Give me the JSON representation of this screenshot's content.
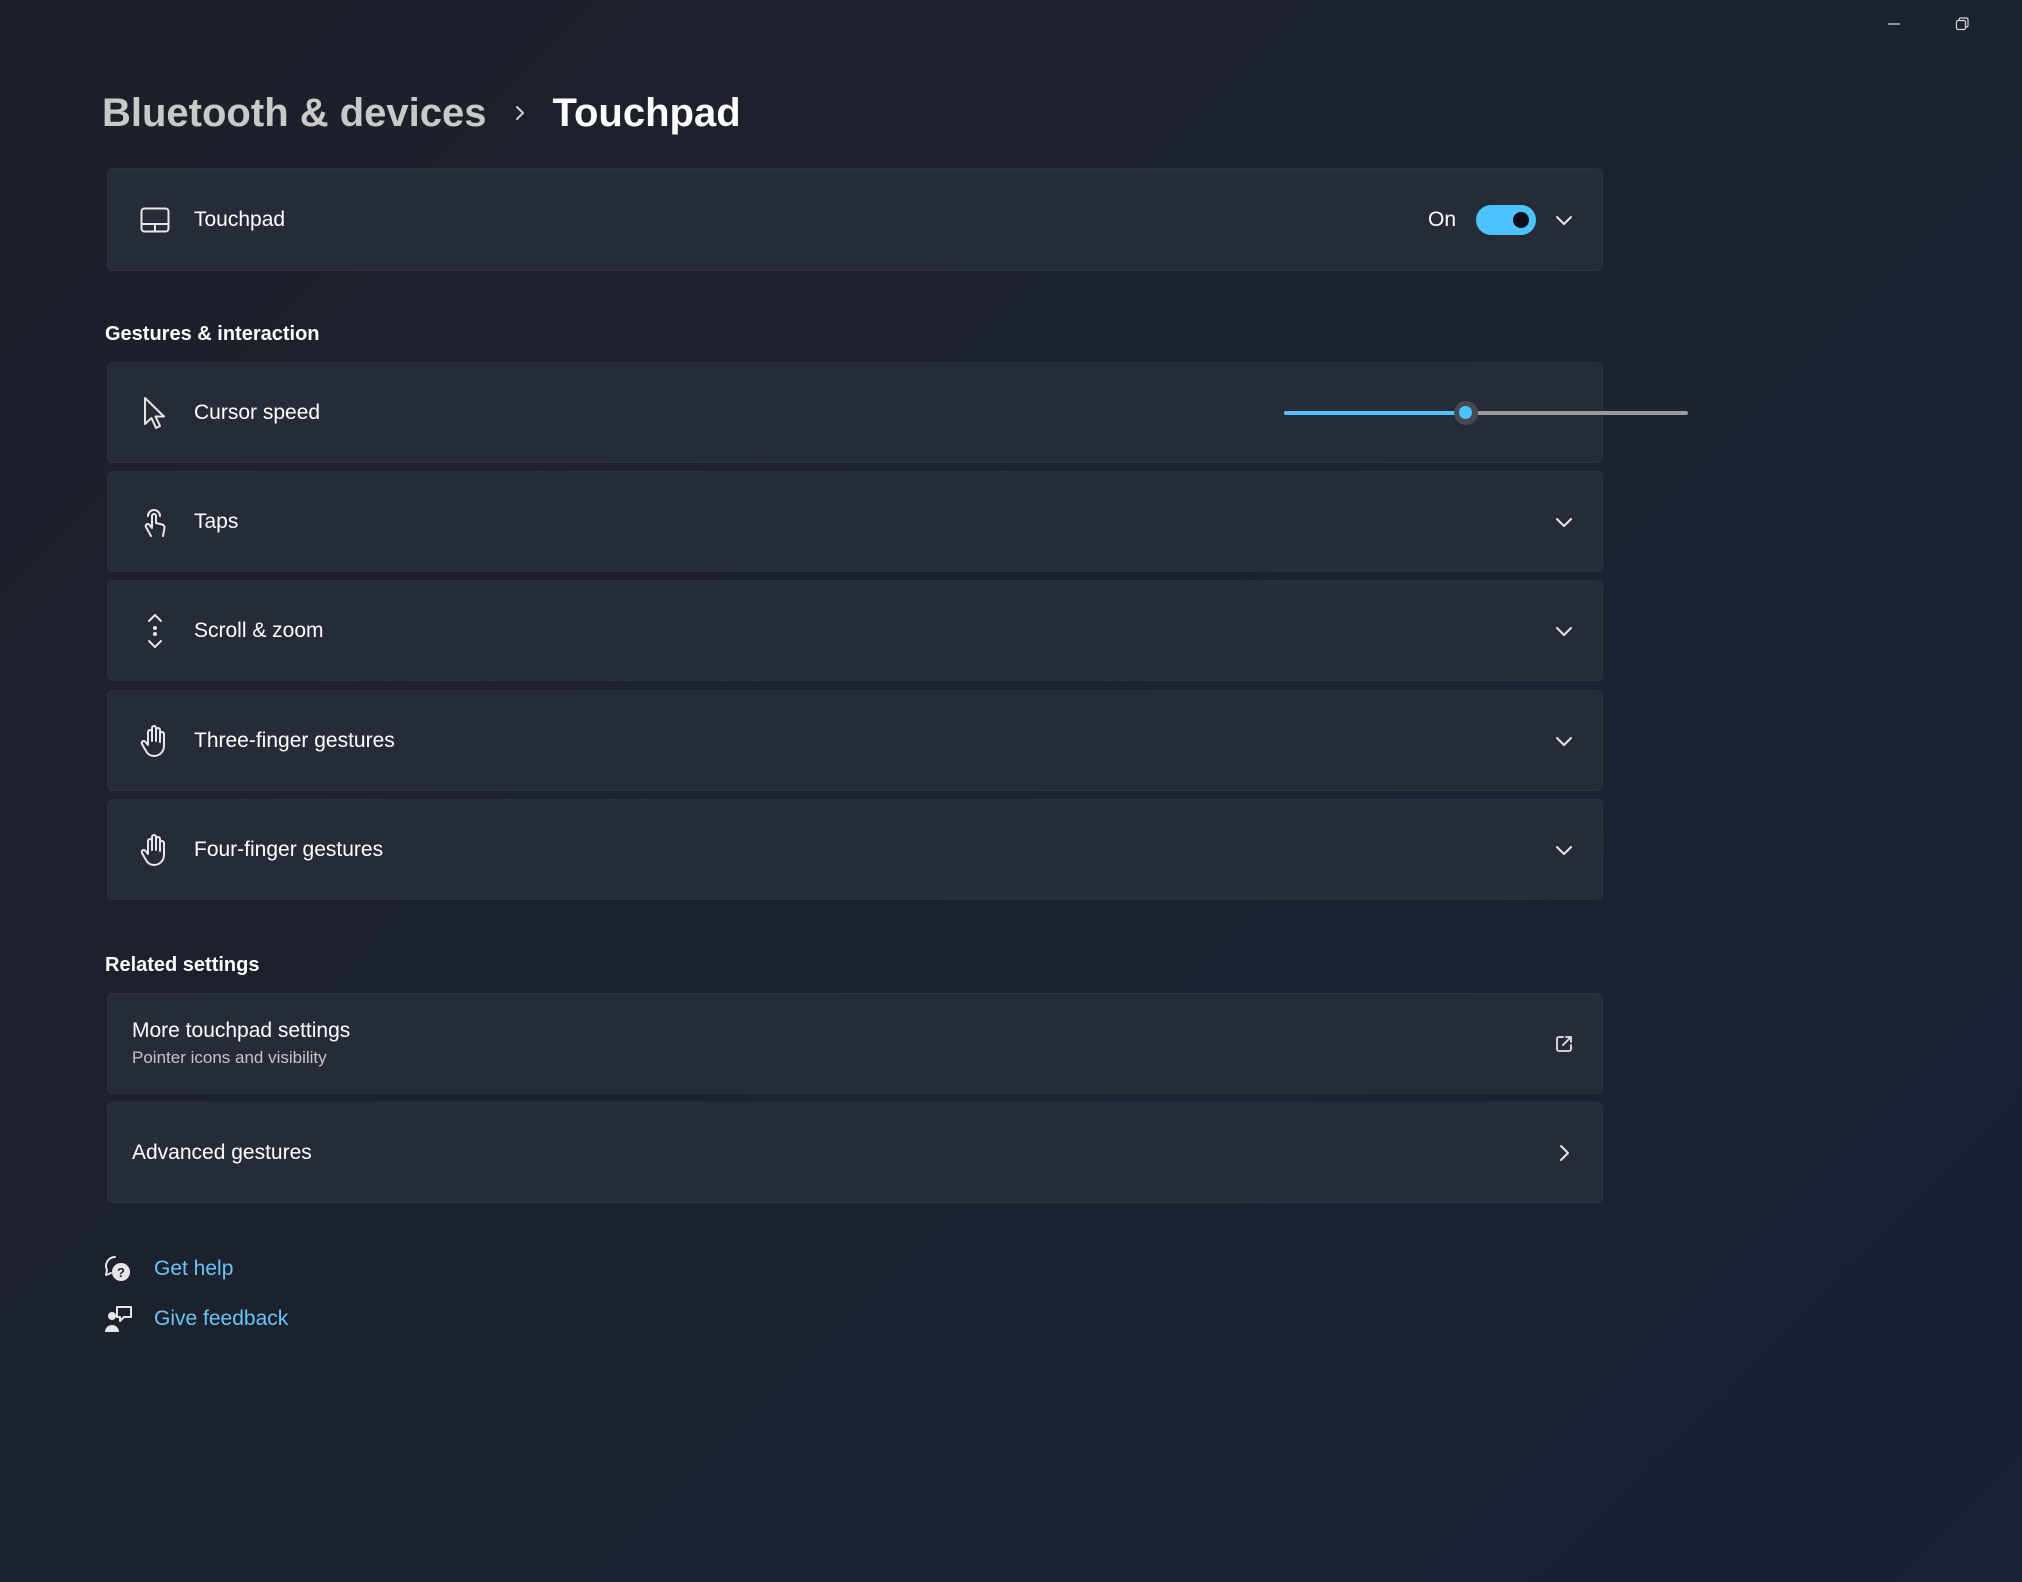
{
  "window": {
    "minimize_label": "Minimize",
    "restore_label": "Restore"
  },
  "breadcrumb": {
    "parent": "Bluetooth & devices",
    "current": "Touchpad"
  },
  "touchpad_card": {
    "label": "Touchpad",
    "toggle_text": "On",
    "toggle_on": true,
    "icon": "touchpad-icon"
  },
  "sections": {
    "gestures_title": "Gestures & interaction",
    "related_title": "Related settings"
  },
  "gestures": {
    "cursor_speed": {
      "label": "Cursor speed",
      "icon": "cursor-icon",
      "value_fraction": 0.45
    },
    "taps": {
      "label": "Taps",
      "icon": "tap-icon"
    },
    "scroll_zoom": {
      "label": "Scroll & zoom",
      "icon": "scroll-icon"
    },
    "three_finger": {
      "label": "Three-finger gestures",
      "icon": "hand-icon"
    },
    "four_finger": {
      "label": "Four-finger gestures",
      "icon": "hand-icon"
    }
  },
  "related": {
    "more_touchpad": {
      "label": "More touchpad settings",
      "sublabel": "Pointer icons and visibility",
      "icon": "external-link-icon"
    },
    "advanced": {
      "label": "Advanced gestures",
      "icon": "chevron-right-icon"
    }
  },
  "help": {
    "get_help": "Get help",
    "give_feedback": "Give feedback"
  },
  "colors": {
    "accent": "#4cc2ff",
    "link": "#69c5f5",
    "card": "#262c37"
  }
}
